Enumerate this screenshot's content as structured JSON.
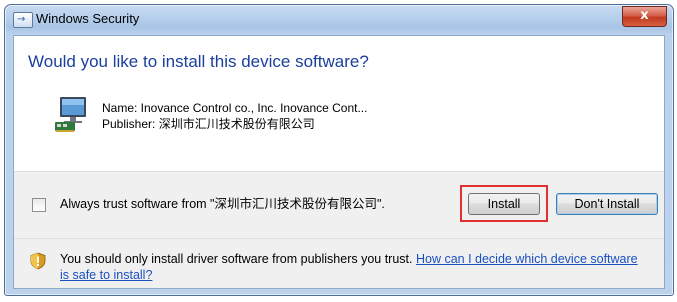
{
  "window": {
    "title": "Windows Security",
    "close_glyph": "x"
  },
  "dialog": {
    "question": "Would you like to install this device software?",
    "name_line": "Name: Inovance Control co., Inc. Inovance Cont...",
    "publisher_line": "Publisher: 深圳市汇川技术股份有限公司",
    "device_icon": "device-icon"
  },
  "footer": {
    "trust_label": "Always trust software from \"深圳市汇川技术股份有限公司\".",
    "install_label": "Install",
    "dont_install_label": "Don't Install",
    "warning_text": "You should only install driver software from publishers you trust. ",
    "warning_link": "How can I decide which device software is safe to install?",
    "shield_icon": "shield-icon"
  },
  "colors": {
    "question_text": "#1a3f9c",
    "link": "#1a4fc0",
    "highlight": "#e03030",
    "close_button": "#c13a20"
  }
}
